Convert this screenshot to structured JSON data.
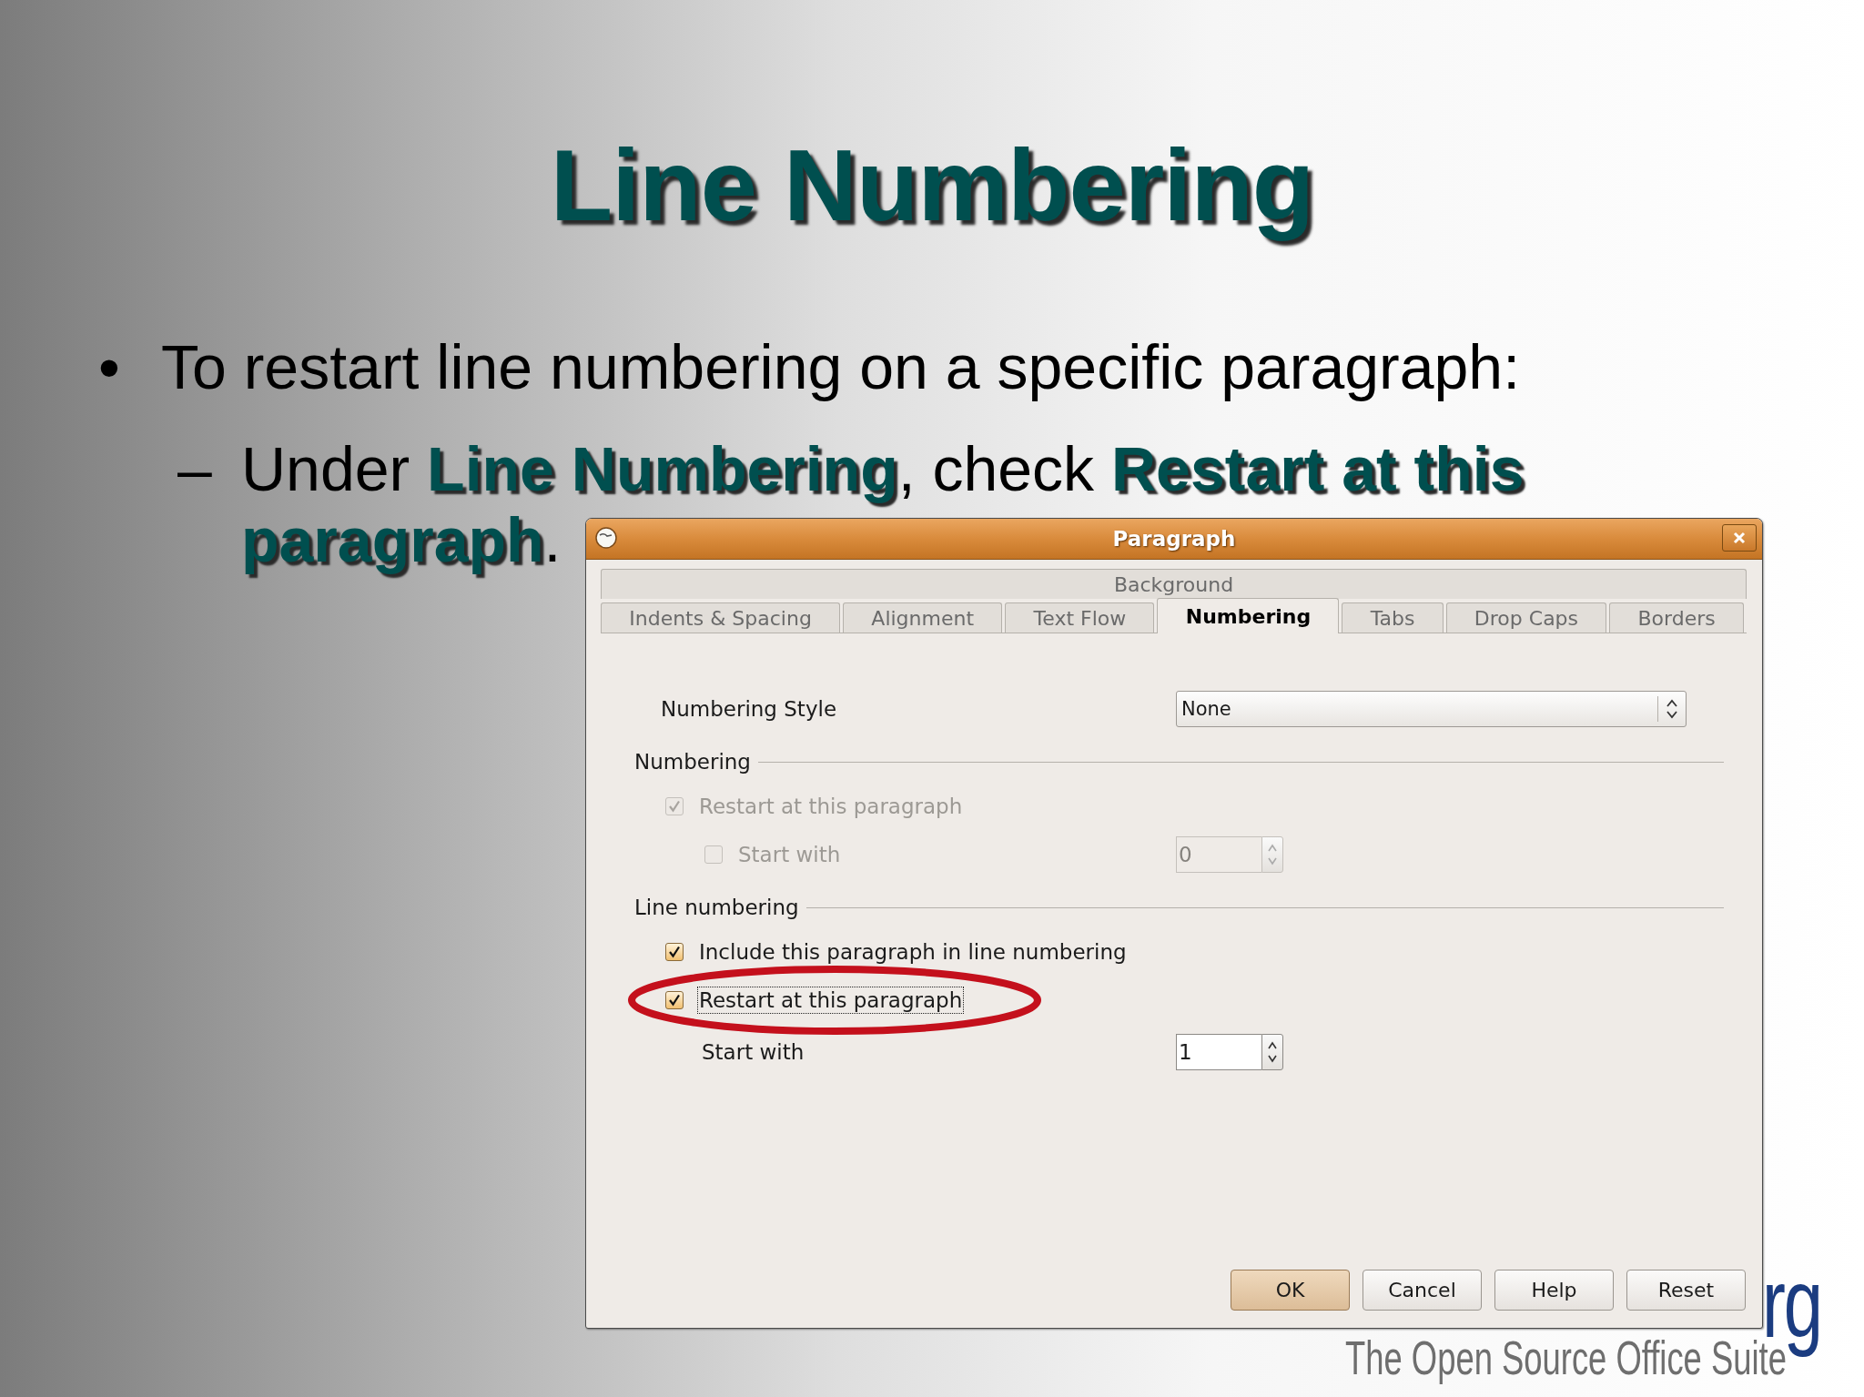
{
  "slide": {
    "title": "Line Numbering",
    "bullets": [
      {
        "marker": "•",
        "text": "To restart line numbering on a specific paragraph:",
        "children": [
          {
            "marker": "–",
            "lines": [
              "Under **Line Numbering**, check **Restart at this**",
              "**paragraph**."
            ]
          }
        ]
      }
    ],
    "logo": {
      "mark_text": "rg",
      "tagline": "The Open Source Office Suite"
    }
  },
  "dialog": {
    "title": "Paragraph",
    "tab_rows": [
      {
        "tabs": [
          {
            "label": "Background",
            "selected": false
          }
        ]
      },
      {
        "tabs": [
          {
            "label": "Indents & Spacing",
            "selected": false
          },
          {
            "label": "Alignment",
            "selected": false
          },
          {
            "label": "Text Flow",
            "selected": false
          },
          {
            "label": "Numbering",
            "selected": true
          },
          {
            "label": "Tabs",
            "selected": false
          },
          {
            "label": "Drop Caps",
            "selected": false
          },
          {
            "label": "Borders",
            "selected": false
          }
        ]
      }
    ],
    "numbering_style": {
      "label": "Numbering Style",
      "value": "None"
    },
    "sections": [
      {
        "title": "Numbering",
        "items": [
          {
            "kind": "checkbox",
            "label": "Restart at this paragraph",
            "checked": true,
            "disabled": true,
            "focused": false,
            "highlighted": false,
            "children": [
              {
                "kind": "checkbox",
                "label": "Start with",
                "checked": false,
                "disabled": true,
                "focused": false,
                "highlighted": false,
                "spin": {
                  "value": "0",
                  "disabled": true
                }
              }
            ]
          }
        ]
      },
      {
        "title": "Line numbering",
        "items": [
          {
            "kind": "checkbox",
            "label": "Include this paragraph in line numbering",
            "checked": true,
            "disabled": false,
            "focused": false,
            "highlighted": false
          },
          {
            "kind": "checkbox",
            "label": "Restart at this paragraph",
            "checked": true,
            "disabled": false,
            "focused": true,
            "highlighted": true,
            "children": [
              {
                "kind": "label",
                "label": "Start with",
                "disabled": false,
                "spin": {
                  "value": "1",
                  "disabled": false
                }
              }
            ]
          }
        ]
      }
    ],
    "buttons": [
      {
        "label": "OK",
        "default": true
      },
      {
        "label": "Cancel",
        "default": false
      },
      {
        "label": "Help",
        "default": false
      },
      {
        "label": "Reset",
        "default": false
      }
    ]
  }
}
